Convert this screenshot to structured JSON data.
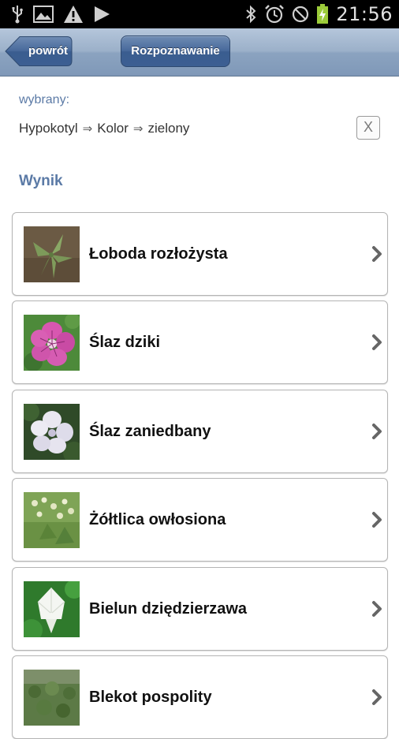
{
  "status_bar": {
    "time": "21:56",
    "left_icons": [
      "usb-icon",
      "image-icon",
      "warning-icon",
      "play-icon"
    ],
    "right_icons": [
      "bluetooth-icon",
      "alarm-icon",
      "no-sim-icon",
      "battery-charging-icon"
    ]
  },
  "navbar": {
    "back_label": "powrót",
    "recognize_label": "Rozpoznawanie"
  },
  "selection": {
    "label": "wybrany:",
    "path": [
      "Hypokotyl",
      "Kolor",
      "zielony"
    ],
    "separator": "⇒",
    "clear_label": "X"
  },
  "results": {
    "heading": "Wynik",
    "items": [
      {
        "name": "Łoboda rozłożysta",
        "thumb": "spreading-orache-photo"
      },
      {
        "name": "Ślaz dziki",
        "thumb": "common-mallow-photo"
      },
      {
        "name": "Ślaz zaniedbany",
        "thumb": "dwarf-mallow-photo"
      },
      {
        "name": "Żółtlica owłosiona",
        "thumb": "shaggy-soldier-photo"
      },
      {
        "name": "Bielun dziędzierzawa",
        "thumb": "thorn-apple-photo"
      },
      {
        "name": "Blekot pospolity",
        "thumb": "fools-parsley-photo"
      }
    ]
  },
  "colors": {
    "accent": "#5b7aa6",
    "navbar": "#8ba3c0",
    "button": "#46689a"
  }
}
